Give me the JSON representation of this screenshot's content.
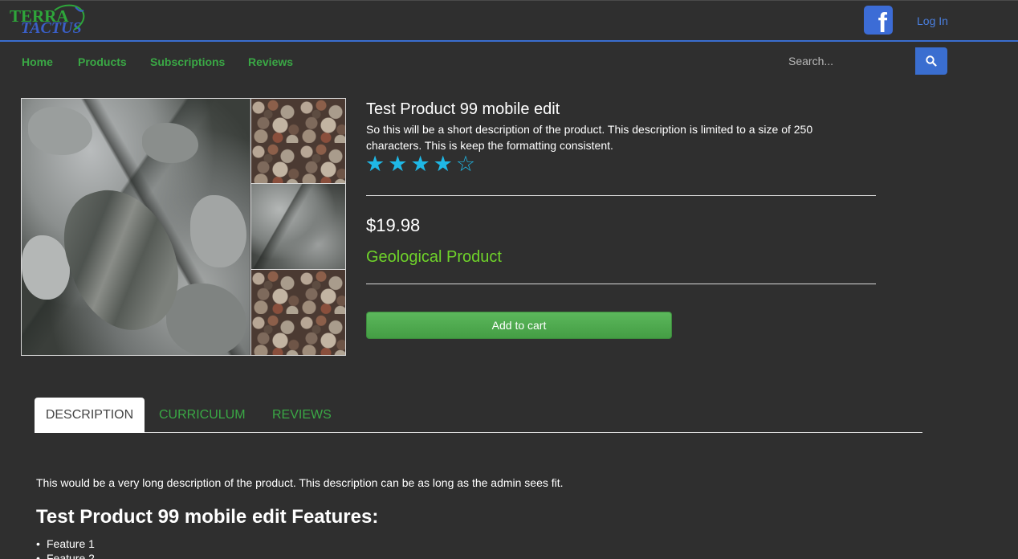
{
  "header": {
    "logo_top": "TERRA",
    "logo_bottom": "TACTUS",
    "facebook_icon": "f",
    "login_label": "Log In"
  },
  "nav": {
    "items": [
      "Home",
      "Products",
      "Subscriptions",
      "Reviews"
    ],
    "search_placeholder": "Search..."
  },
  "product": {
    "title": "Test Product 99 mobile edit",
    "short_description": "So this will be a short description of the product. This description is limited to a size of 250 characters. This is keep the formatting consistent.",
    "rating": 4,
    "rating_max": 5,
    "star_filled": "★",
    "star_empty": "☆",
    "price": "$19.98",
    "category": "Geological Product",
    "add_to_cart_label": "Add to cart"
  },
  "tabs": {
    "items": [
      "DESCRIPTION",
      "CURRICULUM",
      "REVIEWS"
    ],
    "active": "DESCRIPTION"
  },
  "description": {
    "long_description": "This would be a very long description of the product. This description can be as long as the admin sees fit.",
    "features_title": "Test Product 99 mobile edit Features:",
    "features": [
      "Feature 1",
      "Feature 2"
    ]
  },
  "colors": {
    "background": "#2f2f2f",
    "accent_blue": "#3a6ed0",
    "nav_green": "#3aa845",
    "category_green": "#6fd32a",
    "star_blue": "#1fb8e6",
    "button_green": "#5cb85c"
  }
}
